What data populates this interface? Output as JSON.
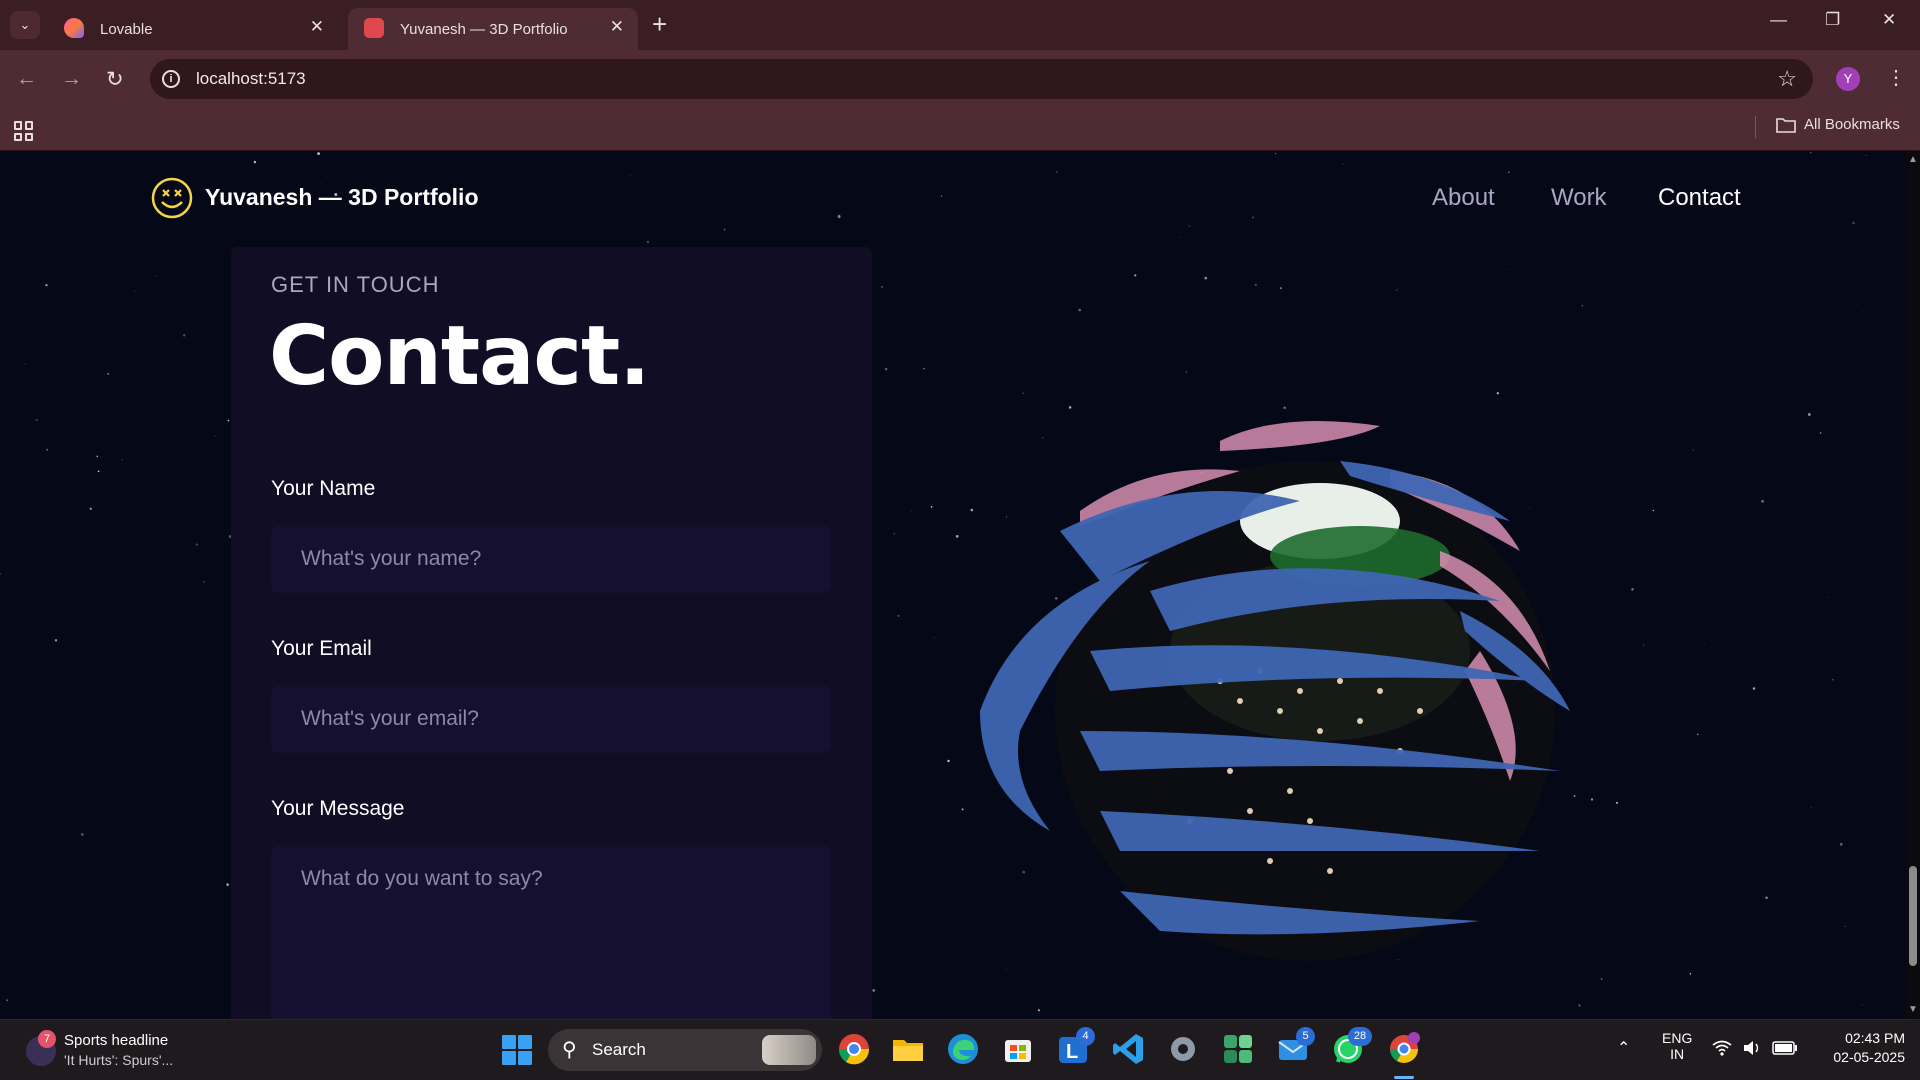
{
  "browser": {
    "tabs": [
      {
        "title": "Lovable",
        "active": false
      },
      {
        "title": "Yuvanesh — 3D Portfolio",
        "active": true
      }
    ],
    "address": "localhost:5173",
    "profile_initial": "Y",
    "bookmarks_label": "All Bookmarks"
  },
  "site": {
    "title": "Yuvanesh — 3D Portfolio",
    "nav": [
      "About",
      "Work",
      "Contact"
    ],
    "current_nav": "Contact"
  },
  "contact": {
    "kicker": "GET IN TOUCH",
    "heading": "Contact.",
    "fields": {
      "name_label": "Your Name",
      "name_placeholder": "What's your name?",
      "email_label": "Your Email",
      "email_placeholder": "What's your email?",
      "message_label": "Your Message",
      "message_placeholder": "What do you want to say?"
    }
  },
  "taskbar": {
    "news_count": "7",
    "news_title": "Sports headline",
    "news_sub": "'It Hurts': Spurs'...",
    "search_label": "Search",
    "badges": {
      "outlook": "4",
      "mail": "5",
      "whatsapp": "28"
    },
    "lang_top": "ENG",
    "lang_bottom": "IN",
    "time": "02:43 PM",
    "date": "02-05-2025"
  },
  "colors": {
    "browser_frame": "#3a1e24",
    "page_bg": "#050816",
    "card_bg": "#100d25",
    "field_bg": "#151030",
    "muted_text": "#aaa6c3"
  }
}
